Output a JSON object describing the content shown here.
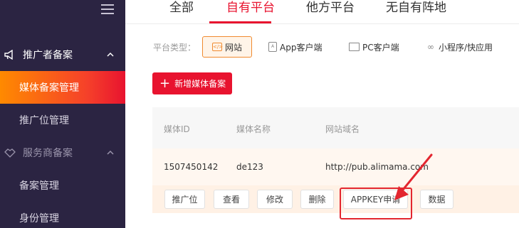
{
  "sidebar": {
    "sections": [
      {
        "label": "推广者备案",
        "icon": "megaphone-icon"
      },
      {
        "label": "服务商备案",
        "icon": "handshake-icon"
      }
    ],
    "items": [
      {
        "label": "媒体备案管理",
        "active": true
      },
      {
        "label": "推广位管理"
      },
      {
        "label": "备案管理"
      },
      {
        "label": "身份管理"
      }
    ]
  },
  "tabs": [
    {
      "label": "全部"
    },
    {
      "label": "自有平台",
      "active": true
    },
    {
      "label": "他方平台"
    },
    {
      "label": "无自有阵地"
    }
  ],
  "platform": {
    "label": "平台类型：",
    "options": [
      {
        "label": "网站",
        "icon": "web-icon",
        "selected": true
      },
      {
        "label": "App客户端",
        "icon": "app-icon"
      },
      {
        "label": "PC客户端",
        "icon": "pc-icon"
      },
      {
        "label": "小程序/快应用",
        "icon": "link-icon"
      }
    ]
  },
  "add_button": {
    "label": "新增媒体备案"
  },
  "table": {
    "headers": [
      "媒体ID",
      "媒体名称",
      "网站域名"
    ],
    "rows": [
      {
        "media_id": "1507450142",
        "media_name": "de123",
        "domain": "http://pub.alimama.com"
      }
    ],
    "actions": [
      "推广位",
      "查看",
      "修改",
      "删除",
      "APPKEY申请",
      "数据"
    ]
  },
  "colors": {
    "sidebar_bg": "#2b2442",
    "accent": "#e8132f",
    "orange": "#f08a2f",
    "row_highlight": "#fff7f0"
  }
}
